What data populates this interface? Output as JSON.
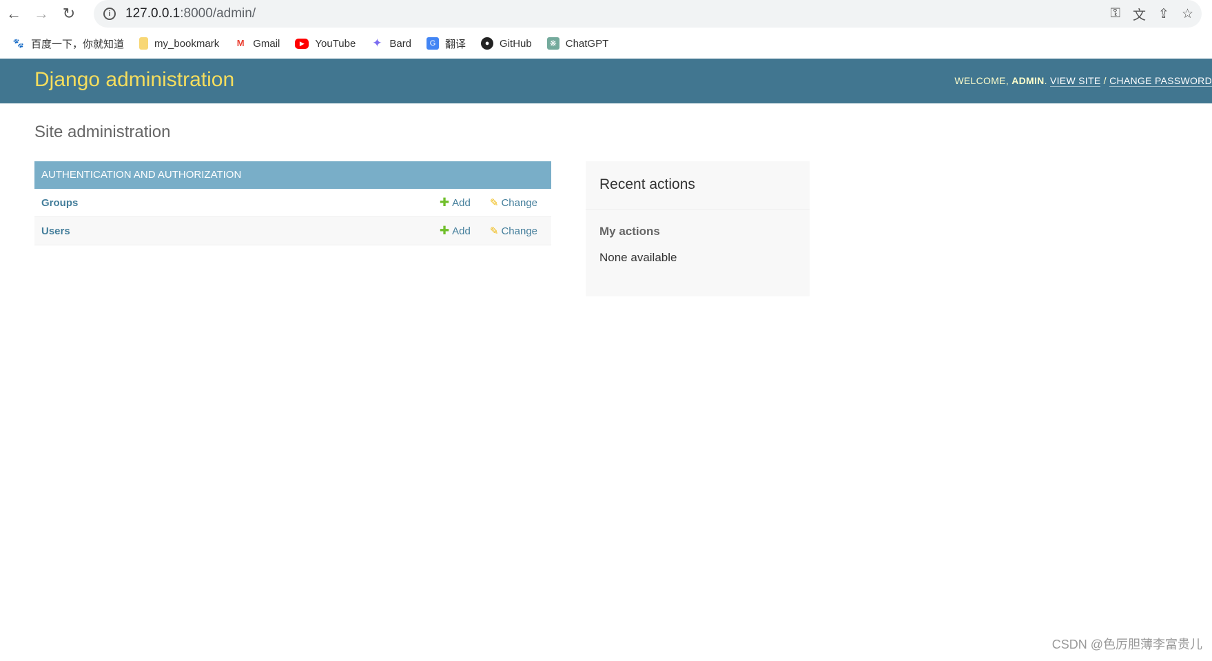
{
  "browser": {
    "url_host": "127.0.0.1",
    "url_rest": ":8000/admin/",
    "bookmarks": [
      {
        "label": "百度一下，你就知道",
        "icon": "baidu-icon"
      },
      {
        "label": "my_bookmark",
        "icon": "folder-icon"
      },
      {
        "label": "Gmail",
        "icon": "gmail-icon"
      },
      {
        "label": "YouTube",
        "icon": "youtube-icon"
      },
      {
        "label": "Bard",
        "icon": "bard-icon"
      },
      {
        "label": "翻译",
        "icon": "translate-icon"
      },
      {
        "label": "GitHub",
        "icon": "github-icon"
      },
      {
        "label": "ChatGPT",
        "icon": "chatgpt-icon"
      }
    ]
  },
  "header": {
    "brand": "Django administration",
    "welcome": "WELCOME, ",
    "user": "ADMIN",
    "dot": ". ",
    "view_site": "VIEW SITE",
    "sep": " / ",
    "change_password": "CHANGE PASSWORD"
  },
  "page_title": "Site administration",
  "module": {
    "caption": "AUTHENTICATION AND AUTHORIZATION",
    "rows": [
      {
        "name": "Groups",
        "add": "Add",
        "change": "Change"
      },
      {
        "name": "Users",
        "add": "Add",
        "change": "Change"
      }
    ]
  },
  "recent": {
    "title": "Recent actions",
    "subtitle": "My actions",
    "empty": "None available"
  },
  "watermark": "CSDN @色厉胆薄李富贵儿",
  "colors": {
    "header": "#417690",
    "brand": "#f5dd5d",
    "caption": "#79aec8",
    "link": "#447e9b"
  }
}
